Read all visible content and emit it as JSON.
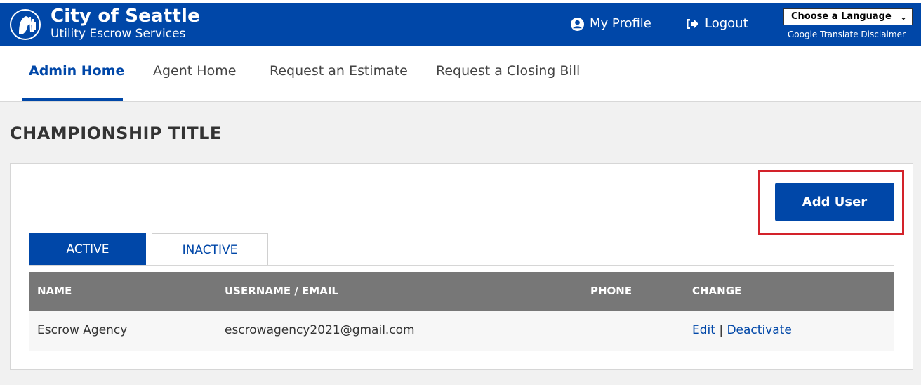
{
  "header": {
    "title": "City of Seattle",
    "subtitle": "Utility Escrow Services",
    "profile_label": "My Profile",
    "logout_label": "Logout",
    "language_select": "Choose a Language",
    "disclaimer": "Google Translate Disclaimer"
  },
  "nav": {
    "items": [
      {
        "label": "Admin Home",
        "active": true
      },
      {
        "label": "Agent Home"
      },
      {
        "label": "Request an Estimate"
      },
      {
        "label": "Request a Closing Bill"
      }
    ]
  },
  "page": {
    "title": "CHAMPIONSHIP TITLE",
    "add_user_label": "Add User",
    "tabs": [
      "ACTIVE",
      "INACTIVE"
    ]
  },
  "table": {
    "columns": [
      "NAME",
      "USERNAME / EMAIL",
      "PHONE",
      "CHANGE"
    ],
    "rows": [
      {
        "name": "Escrow Agency",
        "email": "escrowagency2021@gmail.com",
        "phone": "",
        "edit": "Edit",
        "sep": "|",
        "deactivate": "Deactivate"
      }
    ]
  },
  "colors": {
    "brand_blue": "#0047a8",
    "header_gray": "#777777",
    "highlight_red": "#d3222a"
  }
}
